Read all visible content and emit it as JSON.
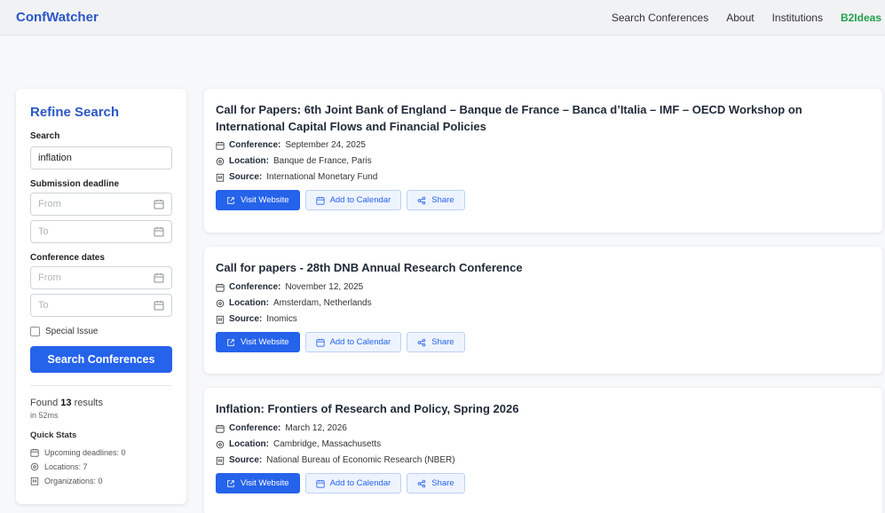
{
  "header": {
    "brand": "ConfWatcher",
    "nav": [
      "Search Conferences",
      "About",
      "Institutions",
      "B2Ideas"
    ]
  },
  "sidebar": {
    "title": "Refine Search",
    "search_label": "Search",
    "search_value": "inflation",
    "submission_label": "Submission deadline",
    "submission_from_placeholder": "From",
    "submission_to_placeholder": "To",
    "conference_label": "Conference dates",
    "conference_from_placeholder": "From",
    "conference_to_placeholder": "To",
    "special_issue_label": "Special Issue",
    "search_button": "Search Conferences",
    "found_prefix": "Found",
    "found_count": "13",
    "found_suffix": "results",
    "found_time": "in 52ms",
    "quick_stats_title": "Quick Stats",
    "quick_stats": [
      "Upcoming deadlines: 0",
      "Locations: 7",
      "Organizations: 0"
    ]
  },
  "results": [
    {
      "title": "Call for Papers: 6th Joint Bank of England – Banque de France – Banca d’Italia – IMF – OECD Workshop on International Capital Flows and Financial Policies",
      "conference": "September 24, 2025",
      "location": "Banque de France, Paris",
      "source": "International Monetary Fund"
    },
    {
      "title": "Call for papers - 28th DNB Annual Research Conference",
      "conference": "November 12, 2025",
      "location": "Amsterdam, Netherlands",
      "source": "Inomics"
    },
    {
      "title": "Inflation: Frontiers of Research and Policy, Spring 2026",
      "conference": "March 12, 2026",
      "location": "Cambridge, Massachusetts",
      "source": "National Bureau of Economic Research (NBER)"
    }
  ],
  "labels": {
    "conference": "Conference:",
    "location": "Location:",
    "source": "Source:",
    "visit": "Visit Website",
    "calendar": "Add to Calendar",
    "share": "Share"
  }
}
